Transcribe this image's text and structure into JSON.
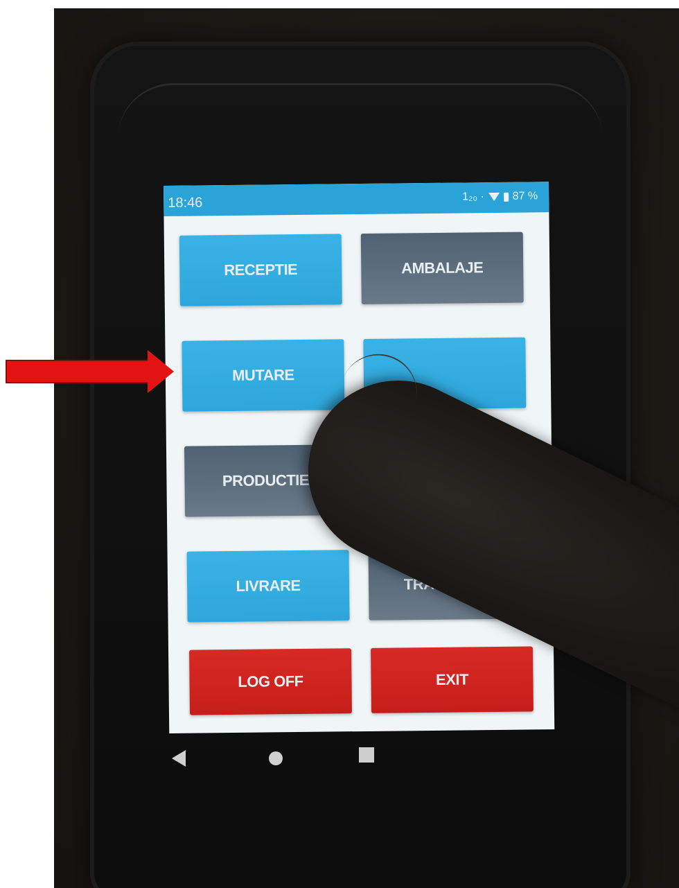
{
  "status_bar": {
    "time": "18:46",
    "icons_text": "1₂₀ ·",
    "battery": "87 %"
  },
  "menu": {
    "buttons": [
      {
        "label": "RECEPTIE",
        "color": "#34aee2"
      },
      {
        "label": "AMBALAJE",
        "color": "#5b6c7c"
      },
      {
        "label": "MUTARE",
        "color": "#34aee2"
      },
      {
        "label": "",
        "color": "#34aee2"
      },
      {
        "label": "PRODUCTIE",
        "color": "#5b6c7c"
      },
      {
        "label": "",
        "color": "#34aee2"
      },
      {
        "label": "LIVRARE",
        "color": "#34aee2"
      },
      {
        "label": "TRANSPORT",
        "color": "#5b6c7c"
      },
      {
        "label": "LOG OFF",
        "color": "#d0241f"
      },
      {
        "label": "EXIT",
        "color": "#d0241f"
      }
    ]
  },
  "navigation": {
    "back": "back-icon",
    "home": "home-icon",
    "recents": "recents-icon"
  },
  "annotation": {
    "arrow_color": "#e41313",
    "points_to": "MUTARE"
  }
}
